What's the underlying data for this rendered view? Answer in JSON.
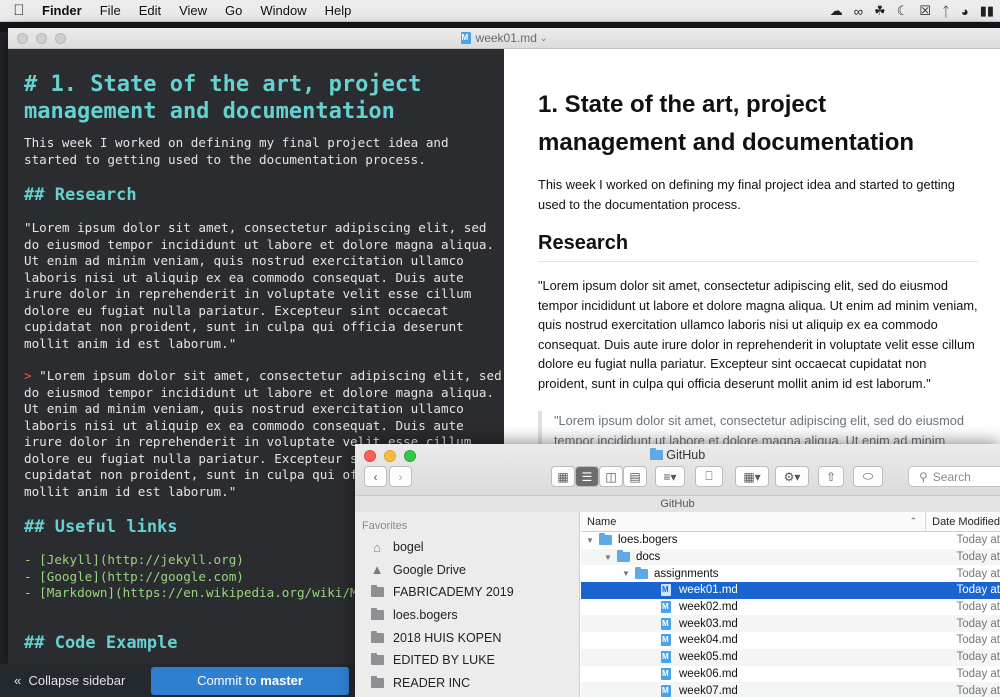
{
  "menubar": {
    "app": "Finder",
    "items": [
      "File",
      "Edit",
      "View",
      "Go",
      "Window",
      "Help"
    ]
  },
  "editor": {
    "title": "week01.md",
    "source": {
      "h1": "# 1. State of the art, project management and documentation",
      "intro": "This week I worked on defining my final project idea and started to getting used to the documentation process.",
      "h2_research": "## Research",
      "lorem": "\"Lorem ipsum dolor sit amet, consectetur adipiscing elit, sed do eiusmod tempor incididunt ut labore et dolore magna aliqua. Ut enim ad minim veniam, quis nostrud exercitation ullamco laboris nisi ut aliquip ex ea commodo consequat. Duis aute irure dolor in reprehenderit in voluptate velit esse cillum dolore eu fugiat nulla pariatur. Excepteur sint occaecat cupidatat non proident, sunt in culpa qui officia deserunt mollit anim id est laborum.\"",
      "quote_marker": ">",
      "quote_text": " \"Lorem ipsum dolor sit amet, consectetur adipiscing elit, sed do eiusmod tempor incididunt ut labore et dolore magna aliqua. Ut enim ad minim veniam, quis nostrud exercitation ullamco laboris nisi ut aliquip ex ea commodo consequat. Duis aute irure dolor in reprehenderit in voluptate velit esse cillum dolore eu fugiat nulla pariatur. Excepteur sint occaecat cupidatat non proident, sunt in culpa qui officia deserunt mollit anim id est laborum.\"",
      "h2_links": "## Useful links",
      "links": [
        "- [Jekyll](http://jekyll.org)",
        "- [Google](http://google.com)",
        "- [Markdown](https://en.wikipedia.org/wiki/Markdown)"
      ],
      "h2_code": "## Code Example"
    },
    "preview": {
      "h1": "1. State of the art, project management and documentation",
      "intro": "This week I worked on defining my final project idea and started to getting used to the documentation process.",
      "h2_research": "Research",
      "lorem": "\"Lorem ipsum dolor sit amet, consectetur adipiscing elit, sed do eiusmod tempor incididunt ut labore et dolore magna aliqua. Ut enim ad minim veniam, quis nostrud exercitation ullamco laboris nisi ut aliquip ex ea commodo consequat. Duis aute irure dolor in reprehenderit in voluptate velit esse cillum dolore eu fugiat nulla pariatur. Excepteur sint occaecat cupidatat non proident, sunt in culpa qui officia deserunt mollit anim id est laborum.\"",
      "quote": "\"Lorem ipsum dolor sit amet, consectetur adipiscing elit, sed do eiusmod tempor incididunt ut labore et dolore magna aliqua. Ut enim ad minim"
    }
  },
  "appbar": {
    "collapse": "Collapse sidebar",
    "commit_prefix": "Commit to",
    "commit_branch": "master"
  },
  "finder": {
    "title": "GitHub",
    "path": "GitHub",
    "search_placeholder": "Search",
    "favorites_header": "Favorites",
    "favorites": [
      {
        "label": "bogel",
        "icon": "home-icon"
      },
      {
        "label": "Google Drive",
        "icon": "google-drive-icon"
      },
      {
        "label": "FABRICADEMY 2019",
        "icon": "folder-icon"
      },
      {
        "label": "loes.bogers",
        "icon": "folder-icon"
      },
      {
        "label": "2018 HUIS KOPEN",
        "icon": "folder-icon"
      },
      {
        "label": "EDITED BY LUKE",
        "icon": "folder-icon"
      },
      {
        "label": "READER INC",
        "icon": "folder-icon"
      }
    ],
    "columns": {
      "name": "Name",
      "date": "Date Modified"
    },
    "rows": [
      {
        "name": "loes.bogers",
        "date": "Today at",
        "kind": "folder",
        "level": 0
      },
      {
        "name": "docs",
        "date": "Today at",
        "kind": "folder",
        "level": 1
      },
      {
        "name": "assignments",
        "date": "Today at",
        "kind": "folder",
        "level": 2
      },
      {
        "name": "week01.md",
        "date": "Today at",
        "kind": "file",
        "level": 3,
        "selected": true
      },
      {
        "name": "week02.md",
        "date": "Today at",
        "kind": "file",
        "level": 3
      },
      {
        "name": "week03.md",
        "date": "Today at",
        "kind": "file",
        "level": 3
      },
      {
        "name": "week04.md",
        "date": "Today at",
        "kind": "file",
        "level": 3
      },
      {
        "name": "week05.md",
        "date": "Today at",
        "kind": "file",
        "level": 3
      },
      {
        "name": "week06.md",
        "date": "Today at",
        "kind": "file",
        "level": 3
      },
      {
        "name": "week07.md",
        "date": "Today at",
        "kind": "file",
        "level": 3
      }
    ]
  }
}
